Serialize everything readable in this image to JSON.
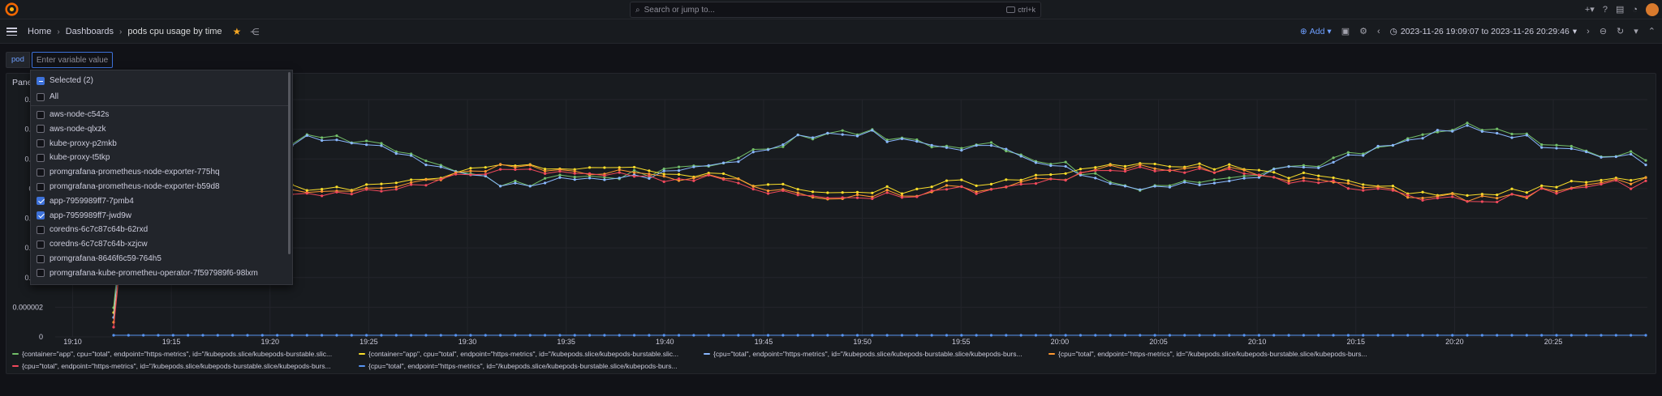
{
  "topbar": {
    "search_placeholder": "Search or jump to...",
    "search_shortcut": "ctrl+k",
    "icons": [
      "plus-icon",
      "help-icon",
      "news-icon",
      "rss-icon",
      "avatar"
    ]
  },
  "navbar": {
    "breadcrumbs": [
      "Home",
      "Dashboards",
      "pods cpu usage by time"
    ],
    "add_label": "Add",
    "time_range": "2023-11-26 19:09:07 to 2023-11-26 20:29:46"
  },
  "variables": {
    "name": "pod",
    "input_placeholder": "Enter variable value"
  },
  "panel": {
    "title": "Panel"
  },
  "dropdown": {
    "selected_label": "Selected (2)",
    "all_label": "All",
    "options": [
      {
        "label": "aws-node-c542s",
        "checked": false
      },
      {
        "label": "aws-node-qlxzk",
        "checked": false
      },
      {
        "label": "kube-proxy-p2mkb",
        "checked": false
      },
      {
        "label": "kube-proxy-t5tkp",
        "checked": false
      },
      {
        "label": "promgrafana-prometheus-node-exporter-775hq",
        "checked": false
      },
      {
        "label": "promgrafana-prometheus-node-exporter-b59d8",
        "checked": false
      },
      {
        "label": "app-7959989ff7-7pmb4",
        "checked": true
      },
      {
        "label": "app-7959989ff7-jwd9w",
        "checked": true
      },
      {
        "label": "coredns-6c7c87c64b-62rxd",
        "checked": false
      },
      {
        "label": "coredns-6c7c87c64b-xzjcw",
        "checked": false
      },
      {
        "label": "promgrafana-8646f6c59-764h5",
        "checked": false
      },
      {
        "label": "promgrafana-kube-prometheu-operator-7f597989f6-98lxm",
        "checked": false
      }
    ]
  },
  "chart_data": {
    "type": "line",
    "title": "",
    "y_ticks": [
      "0.000",
      "0.000",
      "0.000",
      "0.00",
      "0.000",
      "0.000",
      "0.000",
      "0.000002",
      "0"
    ],
    "x_ticks": [
      "19:10",
      "19:15",
      "19:20",
      "19:25",
      "19:30",
      "19:35",
      "19:40",
      "19:45",
      "19:50",
      "19:55",
      "20:00",
      "20:05",
      "20:10",
      "20:15",
      "20:20",
      "20:25"
    ],
    "x_range": [
      "19:09:07",
      "20:29:46"
    ],
    "grid": true,
    "legend_position": "bottom",
    "series": [
      {
        "name": "{container=\"app\", cpu=\"total\", endpoint=\"https-metrics\", id=\"/kubepods.slice/kubepods-burstable.slic...",
        "color": "#73bf69",
        "group": "high"
      },
      {
        "name": "{container=\"app\", cpu=\"total\", endpoint=\"https-metrics\", id=\"/kubepods.slice/kubepods-burstable.slic...",
        "color": "#fade2a",
        "group": "low"
      },
      {
        "name": "{cpu=\"total\", endpoint=\"https-metrics\", id=\"/kubepods.slice/kubepods-burstable.slice/kubepods-burs...",
        "color": "#8ab8ff",
        "group": "high"
      },
      {
        "name": "{cpu=\"total\", endpoint=\"https-metrics\", id=\"/kubepods.slice/kubepods-burstable.slice/kubepods-burs...",
        "color": "#ff9830",
        "group": "low"
      },
      {
        "name": "{cpu=\"total\", endpoint=\"https-metrics\", id=\"/kubepods.slice/kubepods-burstable.slice/kubepods-burs...",
        "color": "#f2495c",
        "group": "low"
      },
      {
        "name": "{cpu=\"total\", endpoint=\"https-metrics\", id=\"/kubepods.slice/kubepods-burstable.slice/kubepods-burs...",
        "color": "#5794f2",
        "group": "zero"
      }
    ]
  },
  "colors": {
    "accent": "#6e9fff",
    "star": "#f5a623",
    "background": "#111217",
    "panel": "#181b1f"
  }
}
